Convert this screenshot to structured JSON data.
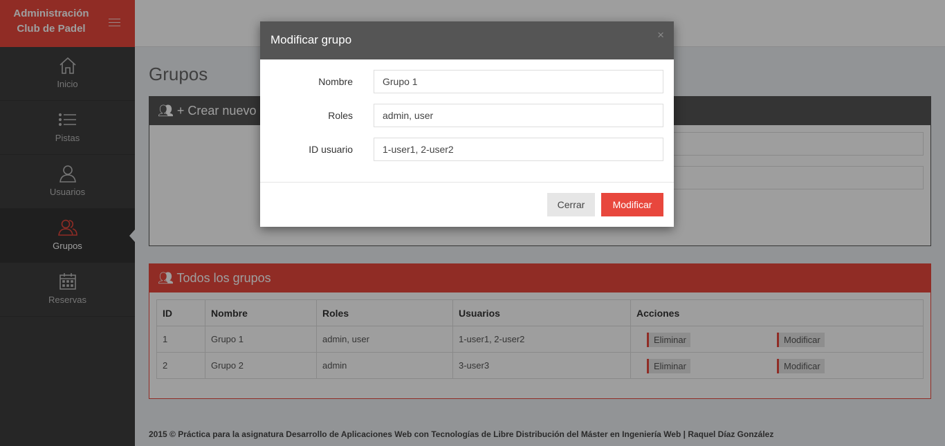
{
  "brand": {
    "line1": "Administración",
    "line2": "Club de Padel"
  },
  "sidebar": {
    "items": [
      {
        "label": "Inicio",
        "icon": "home-icon"
      },
      {
        "label": "Pistas",
        "icon": "list-icon"
      },
      {
        "label": "Usuarios",
        "icon": "user-icon"
      },
      {
        "label": "Grupos",
        "icon": "users-icon",
        "active": true
      },
      {
        "label": "Reservas",
        "icon": "calendar-icon"
      }
    ]
  },
  "main": {
    "title": "Grupos",
    "create_panel": {
      "title": "Crear nuevo g"
    },
    "list_panel": {
      "title": "Todos los grupos"
    },
    "table": {
      "headers": [
        "ID",
        "Nombre",
        "Roles",
        "Usuarios",
        "Acciones"
      ],
      "rows": [
        {
          "id": "1",
          "nombre": "Grupo 1",
          "roles": "admin, user",
          "usuarios": "1-user1, 2-user2"
        },
        {
          "id": "2",
          "nombre": "Grupo 2",
          "roles": "admin",
          "usuarios": "3-user3"
        }
      ],
      "delete_label": "Eliminar",
      "modify_label": "Modificar"
    }
  },
  "footer": {
    "text": "2015 © Práctica para la asignatura Desarrollo de Aplicaciones Web con Tecnologías de Libre Distribución del Máster en Ingeniería Web | Raquel Díaz González"
  },
  "modal": {
    "title": "Modificar grupo",
    "close_glyph": "×",
    "fields": {
      "nombre": {
        "label": "Nombre",
        "value": "Grupo 1"
      },
      "roles": {
        "label": "Roles",
        "value": "admin, user"
      },
      "id_usuario": {
        "label": "ID usuario",
        "value": "1-user1, 2-user2"
      }
    },
    "cancel_label": "Cerrar",
    "submit_label": "Modificar"
  },
  "colors": {
    "accent": "#e8473d",
    "sidebar": "#3e3e3e",
    "panel_dark": "#555555"
  }
}
